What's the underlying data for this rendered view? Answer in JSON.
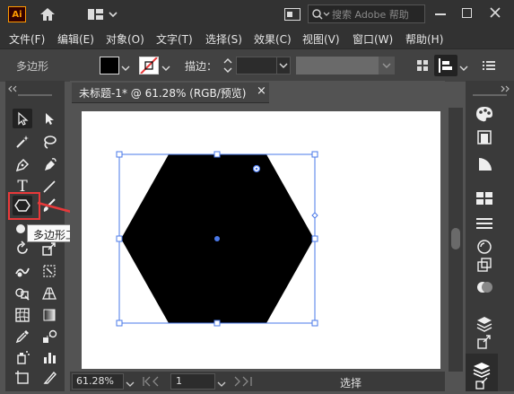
{
  "app": {
    "logo": "Ai"
  },
  "search": {
    "placeholder": "搜索 Adobe 帮助"
  },
  "menu": [
    "文件(F)",
    "编辑(E)",
    "对象(O)",
    "文字(T)",
    "选择(S)",
    "效果(C)",
    "视图(V)",
    "窗口(W)",
    "帮助(H)"
  ],
  "control": {
    "object_label": "多边形",
    "stroke_label": "描边："
  },
  "document": {
    "tab_title": "未标题-1* @ 61.28% (RGB/预览)",
    "close": "×"
  },
  "tooltip": {
    "text": "多边形工具"
  },
  "status": {
    "zoom": "61.28%",
    "artboard": "1",
    "tool": "选择"
  },
  "colors": {
    "highlight": "#e8393a",
    "selection": "#4a78e8",
    "shape_fill": "#000000"
  },
  "icons": [
    "home-icon",
    "workspace-icon",
    "search-icon",
    "minimize-icon",
    "maximize-icon",
    "close-icon"
  ]
}
